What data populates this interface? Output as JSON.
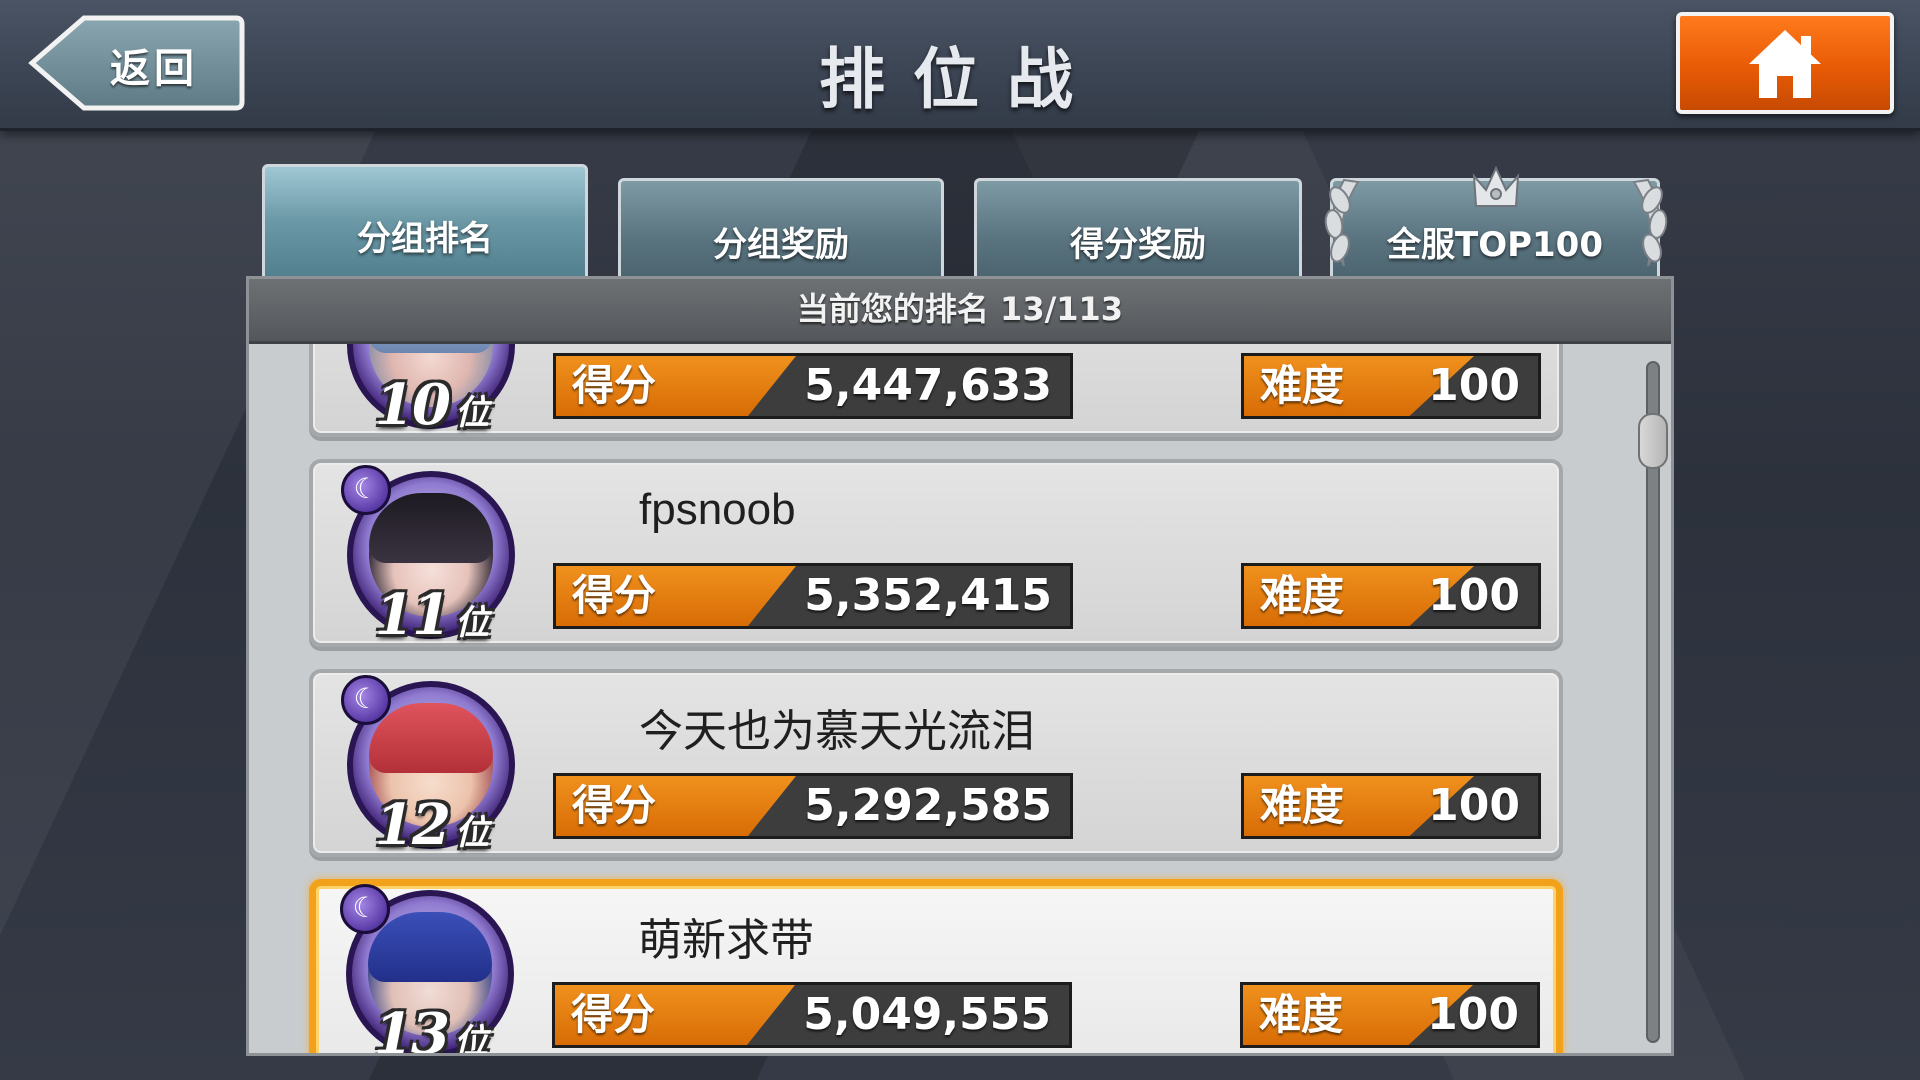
{
  "header": {
    "back_label": "返回",
    "title": "排位战",
    "home_icon": "home-icon"
  },
  "tabs": [
    {
      "label": "分组排名",
      "active": true
    },
    {
      "label": "分组奖励",
      "active": false
    },
    {
      "label": "得分奖励",
      "active": false
    },
    {
      "label": "全服TOP100",
      "active": false
    }
  ],
  "panel": {
    "rank_text": "当前您的排名 13/113"
  },
  "labels": {
    "score": "得分",
    "difficulty": "难度",
    "rank_suffix": "位"
  },
  "rows": [
    {
      "rank": "10",
      "name": "",
      "score": "5,447,633",
      "difficulty": "100"
    },
    {
      "rank": "11",
      "name": "fpsnoob",
      "score": "5,352,415",
      "difficulty": "100"
    },
    {
      "rank": "12",
      "name": "今天也为慕天光流泪",
      "score": "5,292,585",
      "difficulty": "100"
    },
    {
      "rank": "13",
      "name": "萌新求带",
      "score": "5,049,555",
      "difficulty": "100"
    }
  ],
  "colors": {
    "accent_orange": "#e85b06",
    "highlight_border": "#f2a21a",
    "tab_active": "#6b98a6"
  }
}
